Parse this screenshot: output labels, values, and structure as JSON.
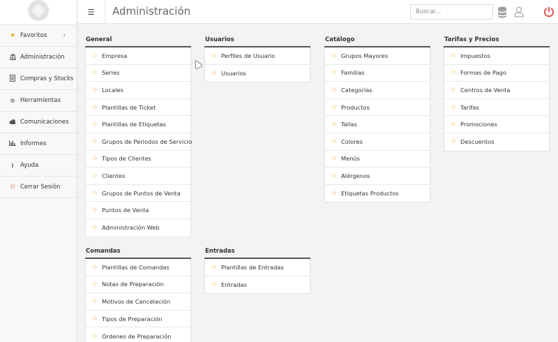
{
  "header": {
    "title": "Administración",
    "search_placeholder": "Buscar..."
  },
  "sidebar": {
    "items": [
      {
        "label": "Favoritos",
        "icon": "star-icon"
      },
      {
        "label": "Administración",
        "icon": "bank-icon"
      },
      {
        "label": "Compras y Stocks",
        "icon": "receipt-icon"
      },
      {
        "label": "Herramientas",
        "icon": "cogs-icon"
      },
      {
        "label": "Comunicaciones",
        "icon": "cloud-icon"
      },
      {
        "label": "Informes",
        "icon": "bar-chart-icon"
      },
      {
        "label": "Ayuda",
        "icon": "info-icon"
      },
      {
        "label": "Cerrar Sesión",
        "icon": "power-icon"
      }
    ]
  },
  "sections": {
    "general": {
      "title": "General",
      "items": [
        "Empresa",
        "Series",
        "Locales",
        "Plantillas de Ticket",
        "Plantillas de Etiquetas",
        "Grupos de Periodos de Servicio",
        "Tipos de Clientes",
        "Clientes",
        "Grupos de Puntos de Venta",
        "Puntos de Venta",
        "Administración Web"
      ]
    },
    "usuarios": {
      "title": "Usuarios",
      "items": [
        "Perfiles de Usuario",
        "Usuarios"
      ]
    },
    "catalogo": {
      "title": "Catálogo",
      "items": [
        "Grupos Mayores",
        "Familias",
        "Categorías",
        "Productos",
        "Tallas",
        "Colores",
        "Menús",
        "Alérgenos",
        "Etiquetas Productos"
      ]
    },
    "tarifas": {
      "title": "Tarifas y Precios",
      "items": [
        "Impuestos",
        "Formas de Pago",
        "Centros de Venta",
        "Tarifas",
        "Promociones",
        "Descuentos"
      ]
    },
    "comandas": {
      "title": "Comandas",
      "items": [
        "Plantillas de Comandas",
        "Notas de Preparación",
        "Motivos de Cancelación",
        "Tipos de Preparación",
        "Órdenes de Preparación"
      ]
    },
    "entradas": {
      "title": "Entradas",
      "items": [
        "Plantillas de Entradas",
        "Entradas"
      ]
    }
  },
  "colors": {
    "star": "#f0ad1c",
    "power": "#d9534f",
    "header_rule": "#555555"
  }
}
